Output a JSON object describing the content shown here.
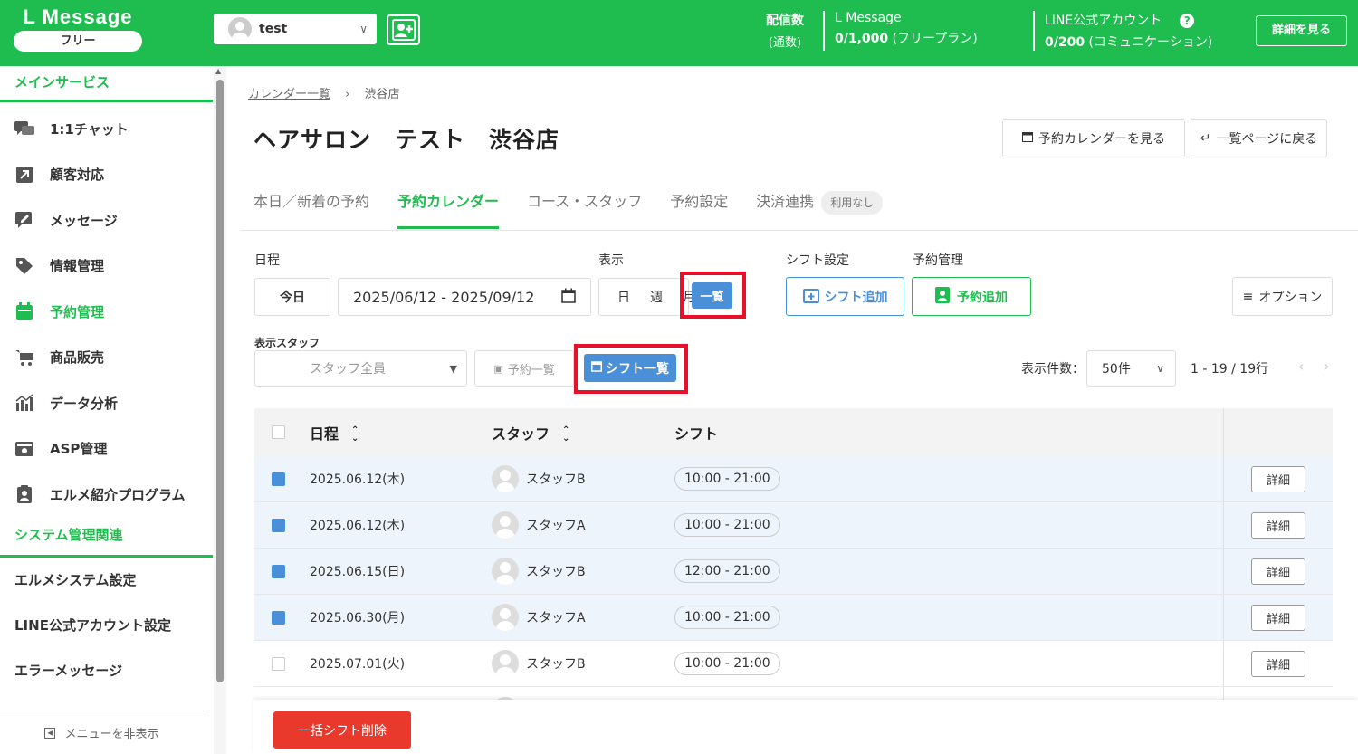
{
  "topbar": {
    "logo": "L Message",
    "plan": "フリー",
    "account_name": "test",
    "stat1_label": "配信数",
    "stat1_sub": "(通数)",
    "stat2_title": "L Message",
    "stat2_value": "0/1,000",
    "stat2_plan": "(フリープラン)",
    "stat3_title": "LINE公式アカウント",
    "stat3_value": "0/200",
    "stat3_plan": "(コミュニケーション)",
    "help": "?",
    "detail_button": "詳細を見る",
    "brand_color": "#1fbd4f"
  },
  "sidebar": {
    "main_heading": "メインサービス",
    "items": [
      {
        "label": "1:1チャット",
        "icon": "chat-icon"
      },
      {
        "label": "顧客対応",
        "icon": "arrow-box-icon"
      },
      {
        "label": "メッセージ",
        "icon": "message-edit-icon"
      },
      {
        "label": "情報管理",
        "icon": "tag-icon"
      },
      {
        "label": "予約管理",
        "icon": "calendar-icon"
      },
      {
        "label": "商品販売",
        "icon": "cart-icon"
      },
      {
        "label": "データ分析",
        "icon": "chart-icon"
      },
      {
        "label": "ASP管理",
        "icon": "asp-icon"
      },
      {
        "label": "エルメ紹介プログラム",
        "icon": "clipboard-user-icon"
      }
    ],
    "system_heading": "システム管理関連",
    "system_items": [
      "エルメシステム設定",
      "LINE公式アカウント設定",
      "エラーメッセージ"
    ],
    "hide_menu": "メニューを非表示"
  },
  "breadcrumb": {
    "link": "カレンダー一覧",
    "current": "渋谷店"
  },
  "page_title": "ヘアサロン　テスト　渋谷店",
  "header_buttons": {
    "view_calendar": "予約カレンダーを見る",
    "back_list": "一覧ページに戻る"
  },
  "tabs": [
    "本日／新着の予約",
    "予約カレンダー",
    "コース・スタッフ",
    "予約設定",
    "決済連携"
  ],
  "tab_badge": "利用なし",
  "filters": {
    "schedule_label": "日程",
    "today": "今日",
    "date_range": "2025/06/12 - 2025/09/12",
    "display_label": "表示",
    "view_day": "日",
    "view_week": "週",
    "view_month": "月",
    "view_list": "一覧",
    "shift_setting_label": "シフト設定",
    "add_shift": "シフト追加",
    "reservation_label": "予約管理",
    "add_reservation": "予約追加",
    "options": "オプション",
    "staff_label": "表示スタッフ",
    "staff_placeholder": "スタッフ全員",
    "reservation_list": "予約一覧",
    "shift_list": "シフト一覧",
    "per_page_label": "表示件数：",
    "per_page": "50件",
    "range": "1 - 19 / 19行"
  },
  "table": {
    "headers": {
      "date": "日程",
      "staff": "スタッフ",
      "shift": "シフト"
    },
    "detail_label": "詳細",
    "rows": [
      {
        "date": "2025.06.12(木)",
        "staff": "スタッフB",
        "shift": "10:00 - 21:00",
        "checked": true
      },
      {
        "date": "2025.06.12(木)",
        "staff": "スタッフA",
        "shift": "10:00 - 21:00",
        "checked": true
      },
      {
        "date": "2025.06.15(日)",
        "staff": "スタッフB",
        "shift": "12:00 - 21:00",
        "checked": true
      },
      {
        "date": "2025.06.30(月)",
        "staff": "スタッフA",
        "shift": "10:00 - 21:00",
        "checked": true
      },
      {
        "date": "2025.07.01(火)",
        "staff": "スタッフB",
        "shift": "10:00 - 21:00",
        "checked": false
      }
    ]
  },
  "bulk_delete": "一括シフト削除"
}
